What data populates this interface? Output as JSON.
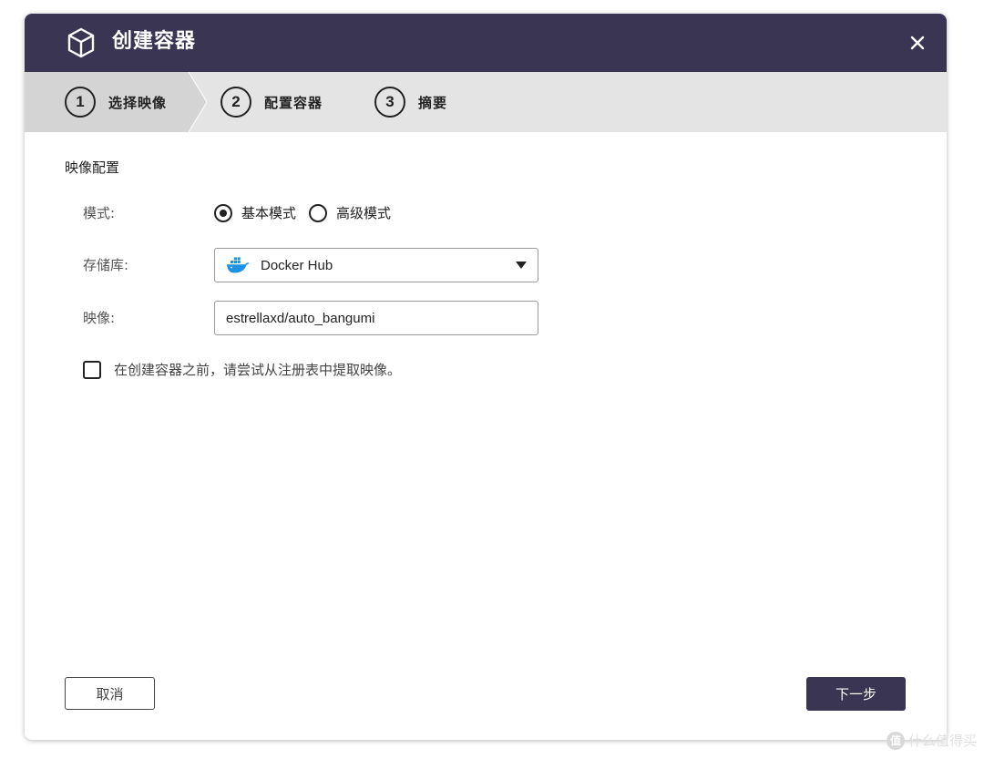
{
  "dialog": {
    "title": "创建容器",
    "title_icon": "cube-icon",
    "close_icon": "close-icon"
  },
  "steps": [
    {
      "number": "1",
      "label": "选择映像",
      "active": true
    },
    {
      "number": "2",
      "label": "配置容器",
      "active": false
    },
    {
      "number": "3",
      "label": "摘要",
      "active": false
    }
  ],
  "form": {
    "section_title": "映像配置",
    "mode": {
      "label": "模式:",
      "options": [
        {
          "label": "基本模式",
          "checked": true
        },
        {
          "label": "高级模式",
          "checked": false
        }
      ]
    },
    "repository": {
      "label": "存储库:",
      "value": "Docker Hub",
      "icon": "docker-icon"
    },
    "image": {
      "label": "映像:",
      "value": "estrellaxd/auto_bangumi"
    },
    "pull_checkbox": {
      "label": "在创建容器之前，请尝试从注册表中提取映像。",
      "checked": false
    }
  },
  "footer": {
    "cancel_label": "取消",
    "next_label": "下一步"
  },
  "watermark": {
    "badge": "值",
    "text": "什么值得买"
  },
  "colors": {
    "header_bg": "#3a3553",
    "stepbar_bg": "#e4e4e4",
    "active_step_bg": "#d4d4d4",
    "docker_blue": "#1d91e6"
  }
}
